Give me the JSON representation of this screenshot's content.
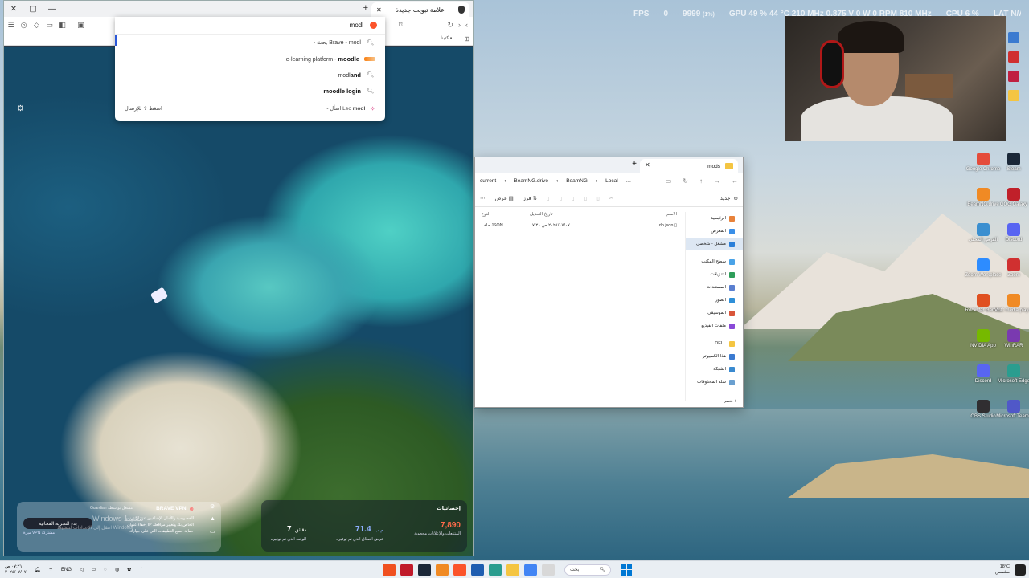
{
  "overlay": {
    "fps_label": "FPS",
    "fps_value": "0",
    "frames": "9999",
    "frames_pct": "(1%)",
    "gpu": "GPU 49 % 44 °C 210 MHz 0.875 V 0 W 0 RPM 810 MHz",
    "cpu": "CPU 6 %",
    "ram": "LAT N/A"
  },
  "browser": {
    "tab_title": "علامة تبويب جديدة",
    "tab_close": "✕",
    "new_tab": "+",
    "window_controls": {
      "close": "✕",
      "restore": "▢",
      "minimize": "—"
    },
    "address_text": "modl",
    "bookmark_label": "كتبنا",
    "suggestions": [
      {
        "bold": "modl",
        "rest": " - بحث Brave",
        "icon": "search-icon"
      },
      {
        "bold": "moodle",
        "rest": "e-learning platform - ",
        "icon": "moodle-icon"
      },
      {
        "bold": "modl",
        "rest": "and",
        "icon": "search-icon"
      },
      {
        "bold": "moodle login",
        "rest": "",
        "icon": "search-icon"
      }
    ],
    "leo_row": {
      "bold": "modl",
      "rest": " - اسأل Leo",
      "hint": "اضغط ⇧ للإرسال"
    },
    "vpn": {
      "title": "BRAVE VPN",
      "brand": "Guardian مشغل بواسطة",
      "line1": "الخصوصية والأمان الإضافيين عبر الإنترنت",
      "line2": "إخفاء عنوان IP الخاص بك وتغيير مواقعك",
      "line3": "حماية جميع التطبيقات التي على جهازك",
      "button": "بدء التجربة المجانية",
      "link": "ميزة VPN مشتركة"
    },
    "activation_title": "Windows تنشيط",
    "activation_sub": "انتقل إلى الإعدادات لتنشيط Windows",
    "stats": {
      "title": "إحصائيات",
      "blocked_value": "7,890",
      "blocked_caption": "المتتبعات والإعلانات محجوبة",
      "bandwidth_value": "71.4",
      "bandwidth_unit": "م.ب",
      "bandwidth_caption": "عرض النطاق الذي تم توفيره",
      "time_value": "7",
      "time_unit": "دقائق",
      "time_caption": "الوقت الذي تم توفيره"
    }
  },
  "explorer": {
    "tab_title": "mods",
    "breadcrumb": [
      "current",
      "BeamNG.drive",
      "BeamNG",
      "Local",
      "…"
    ],
    "new_label": "جديد",
    "view_label": "عرض",
    "sort_label": "فرز",
    "columns": {
      "name": "الاسم",
      "date": "تاريخ التعديل",
      "type": "النوع"
    },
    "files": [
      {
        "name": "db.json",
        "date": "٢٠٢٤/٠٧/٠٧ ص ٠٧:٢١",
        "type": "ملف JSON"
      }
    ],
    "sidebar": [
      {
        "label": "الرئيسية",
        "color": "#e8823a"
      },
      {
        "label": "المعرض",
        "color": "#3a8fe8"
      },
      {
        "label": "مشغل - شخصي",
        "color": "#2b7fd9",
        "selected": true
      },
      {
        "label": "سطح المكتب",
        "color": "#4aa3e8"
      },
      {
        "label": "التنزيلات",
        "color": "#2e9e5a"
      },
      {
        "label": "المستندات",
        "color": "#5a7fd0"
      },
      {
        "label": "الصور",
        "color": "#2e8fd8"
      },
      {
        "label": "الموسيقى",
        "color": "#d9563a"
      },
      {
        "label": "ملفات الفيديو",
        "color": "#8a4ad8"
      },
      {
        "label": "DELL",
        "color": "#f4c542"
      },
      {
        "label": "هذا الكمبيوتر",
        "color": "#3a7ad0"
      },
      {
        "label": "الشبكة",
        "color": "#3a8ad0"
      },
      {
        "label": "سلة المحذوفات",
        "color": "#6aa0d0"
      }
    ],
    "status": "١ عنصر"
  },
  "desktop_icons": [
    {
      "label": "Google Chrome",
      "color": "#e44b3a"
    },
    {
      "label": "Steam",
      "color": "#1b2838"
    },
    {
      "label": "BeamNG.drive",
      "color": "#f08a24"
    },
    {
      "label": "GOG Galaxy",
      "color": "#c0202a"
    },
    {
      "label": "القرص المحلي",
      "color": "#3a8fd0"
    },
    {
      "label": "Discord",
      "color": "#5865f2"
    },
    {
      "label": "Zoom Workplace",
      "color": "#2d8cff"
    },
    {
      "label": "Zoom",
      "color": "#d03030"
    },
    {
      "label": "Rockstar Games",
      "color": "#e05020"
    },
    {
      "label": "VLC media player",
      "color": "#f08a24"
    },
    {
      "label": "NVIDIA App",
      "color": "#76b900"
    },
    {
      "label": "WinRAR",
      "color": "#7a3ab0"
    },
    {
      "label": "Discord",
      "color": "#5865f2"
    },
    {
      "label": "Microsoft Edge",
      "color": "#2a9d8f"
    },
    {
      "label": "OBS Studio",
      "color": "#302e31"
    },
    {
      "label": "Microsoft Teams",
      "color": "#5058c8"
    }
  ],
  "taskbar": {
    "clock_time": "٠٧:٢١ ص",
    "clock_date": "٢٠٢٤/٠٧/٠٧",
    "lang": "ENG",
    "search_label": "بحث",
    "weather_temp": "18°C",
    "weather_desc": "مشمس"
  }
}
